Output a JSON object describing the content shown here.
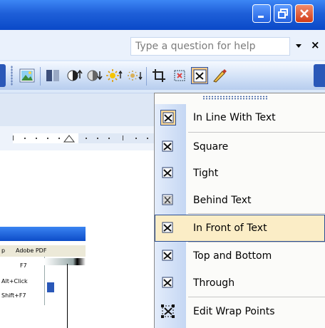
{
  "window": {
    "buttons": [
      "minimize",
      "restore",
      "close"
    ]
  },
  "help": {
    "placeholder": "Type a question for help"
  },
  "menu": {
    "items": [
      {
        "label": "In Line With Text",
        "icon": "wrap-inline-icon",
        "checked": true
      },
      {
        "label": "Square",
        "icon": "wrap-square-icon"
      },
      {
        "label": "Tight",
        "icon": "wrap-tight-icon"
      },
      {
        "label": "Behind Text",
        "icon": "wrap-behind-icon"
      },
      {
        "label": "In Front of Text",
        "icon": "wrap-front-icon",
        "highlighted": true
      },
      {
        "label": "Top and Bottom",
        "icon": "wrap-top-bottom-icon"
      },
      {
        "label": "Through",
        "icon": "wrap-through-icon"
      },
      {
        "label": "Edit Wrap Points",
        "icon": "edit-wrap-points-icon"
      }
    ]
  },
  "mini": {
    "menu_p": "p",
    "menu_pdf": "Adobe PDF",
    "f7": "F7",
    "altclick": "Alt+Click",
    "shiftf7": "Shift+F7"
  }
}
